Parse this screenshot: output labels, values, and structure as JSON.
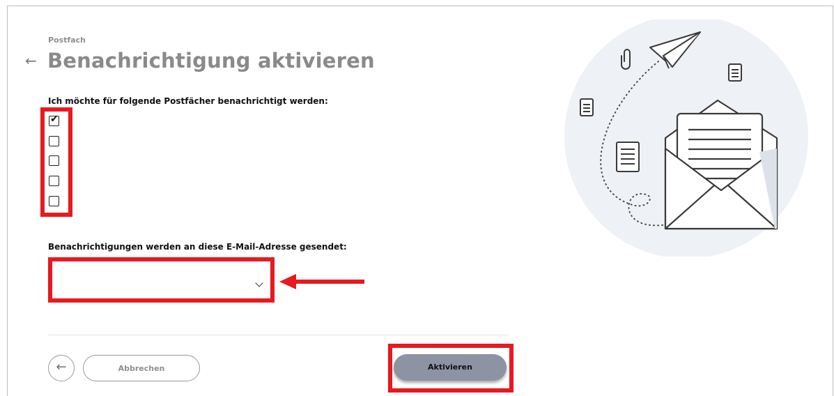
{
  "header": {
    "eyebrow": "Postfach",
    "back_arrow": "←",
    "title": "Benachrichtigung aktivieren"
  },
  "mailboxes": {
    "label": "Ich möchte für folgende Postfächer benachrichtigt werden:",
    "checkbox_states": [
      true,
      false,
      false,
      false,
      false
    ],
    "check_glyph": "✔"
  },
  "email": {
    "label": "Benachrichtigungen werden an diese E-Mail-Adresse gesendet:",
    "selected_value": ""
  },
  "footer": {
    "back_glyph": "←",
    "cancel_label": "Abbrechen",
    "activate_label": "Aktivieren"
  },
  "colors": {
    "annotation_red": "#e8191f",
    "activate_button": "#8d93a3",
    "title_gray": "#8a8a8a",
    "illustration_circle": "#eef1f5"
  },
  "illustration_icons": [
    "paper-plane-icon",
    "paperclip-icon",
    "document-icon",
    "envelope-icon"
  ]
}
